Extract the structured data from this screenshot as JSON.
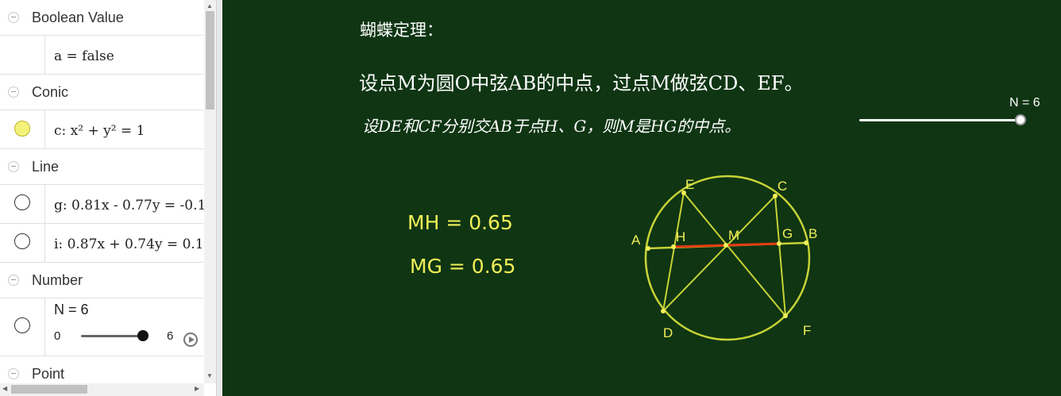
{
  "algebra": {
    "groups": {
      "boolean": "Boolean Value",
      "conic": "Conic",
      "line": "Line",
      "number": "Number",
      "point": "Point"
    },
    "items": {
      "a": "a = false",
      "c": "c: x² + y² = 1",
      "g": "g: 0.81x - 0.77y = -0.1",
      "i": "i: 0.87x + 0.74y = 0.1",
      "n": "N = 6",
      "n_min": "0",
      "n_max": "6"
    },
    "slider_value_fraction": 1.0
  },
  "graphics": {
    "title": "蝴蝶定理：",
    "line1": "设点M为圆O中弦AB的中点，过点M做弦CD、EF。",
    "line2": "设DE和CF分别交AB于点H、G，则M是HG的中点。",
    "slider_label": "N = 6",
    "slider_value_fraction": 1.0,
    "mh": "MH  =  0.65",
    "mg": "MG  =  0.65",
    "points": {
      "A": "A",
      "B": "B",
      "C": "C",
      "D": "D",
      "E": "E",
      "F": "F",
      "G": "G",
      "H": "H",
      "M": "M"
    },
    "colors": {
      "background": "#0f3513",
      "circle": "#c7d337",
      "segment": "#e23b12",
      "point": "#f2f058",
      "label": "#f2f058"
    }
  }
}
